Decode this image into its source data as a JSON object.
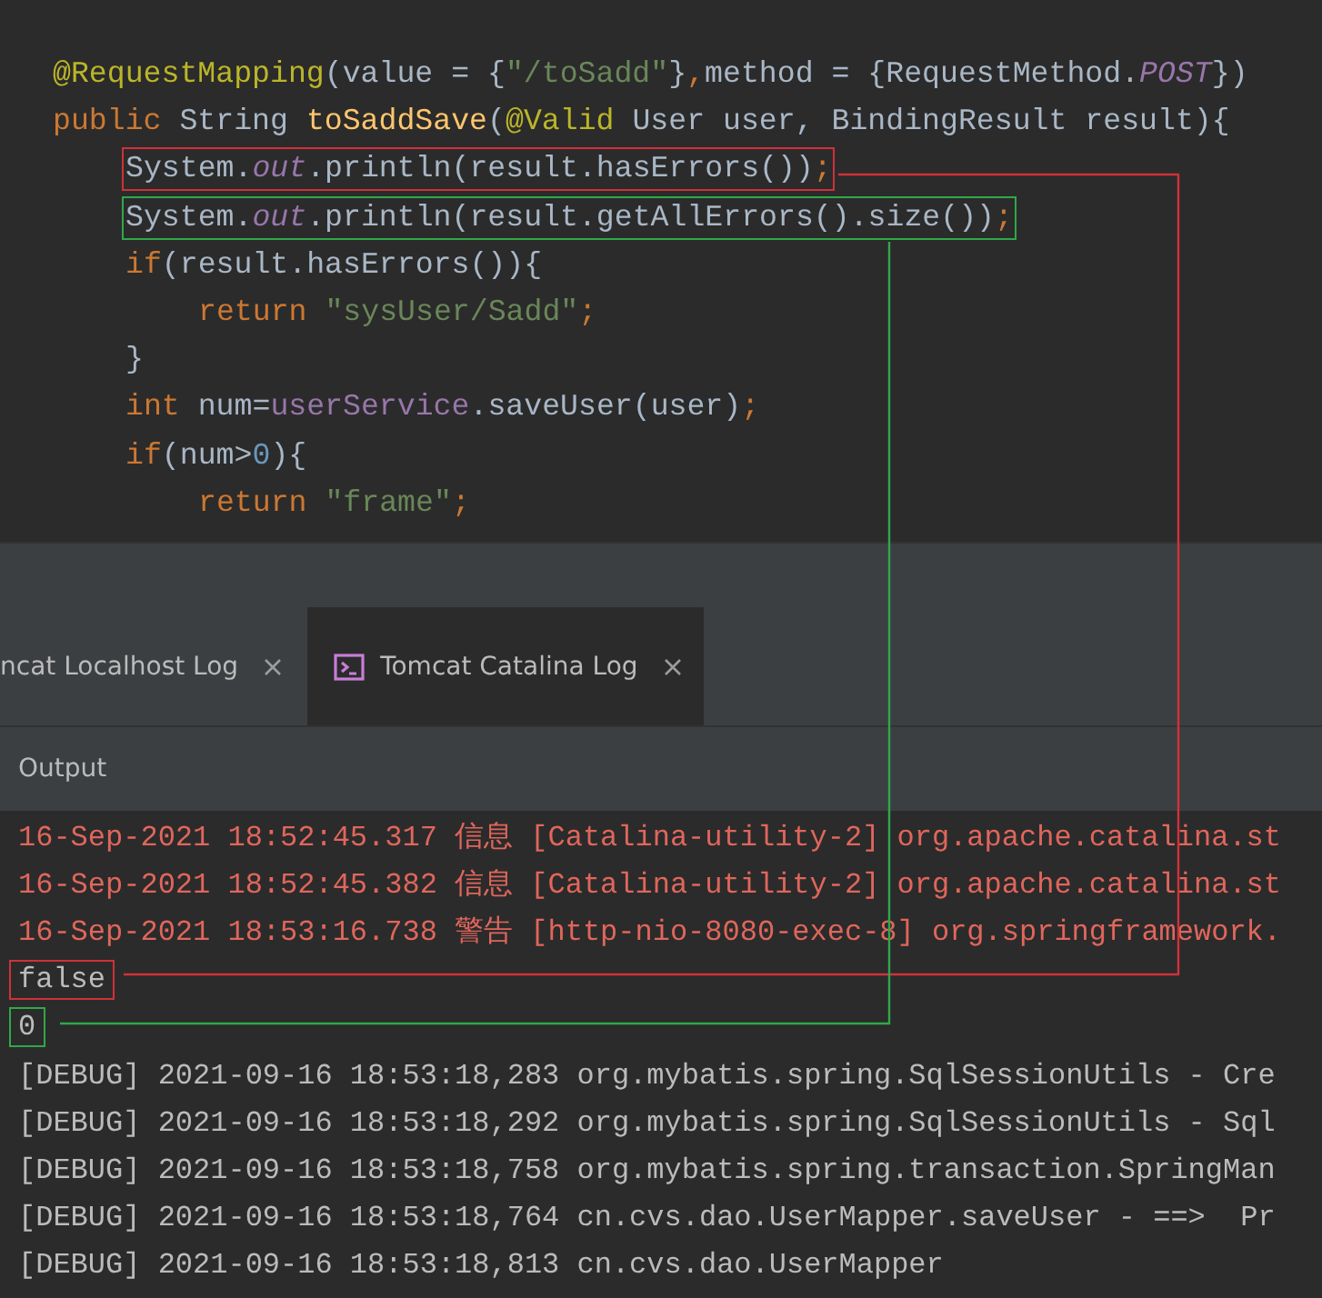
{
  "editor": {
    "lines": [
      {
        "tokens": [
          {
            "kind": "annotation",
            "text": "@RequestMapping"
          },
          {
            "kind": "plain",
            "text": "(value = {"
          },
          {
            "kind": "string",
            "text": "\"/toSadd\""
          },
          {
            "kind": "plain",
            "text": "}"
          },
          {
            "kind": "keyword",
            "text": ","
          },
          {
            "kind": "plain",
            "text": "method = {RequestMethod."
          },
          {
            "kind": "constant",
            "text": "POST"
          },
          {
            "kind": "plain",
            "text": "})"
          }
        ]
      },
      {
        "tokens": [
          {
            "kind": "keyword",
            "text": "public "
          },
          {
            "kind": "plain",
            "text": "String "
          },
          {
            "kind": "method",
            "text": "toSaddSave"
          },
          {
            "kind": "plain",
            "text": "("
          },
          {
            "kind": "annotation",
            "text": "@Valid"
          },
          {
            "kind": "plain",
            "text": " User user, BindingResult result){"
          }
        ],
        "children": [
          {
            "color": "#d0313a",
            "tokens": [
              {
                "kind": "plain",
                "text": "System."
              },
              {
                "kind": "constant",
                "text": "out"
              },
              {
                "kind": "plain",
                "text": ".println(result.hasErrors())"
              },
              {
                "kind": "keyword",
                "text": ";"
              }
            ]
          },
          {
            "color": "#2fa84a",
            "tokens": [
              {
                "kind": "plain",
                "text": "System."
              },
              {
                "kind": "constant",
                "text": "out"
              },
              {
                "kind": "plain",
                "text": ".println(result.getAllErrors().size())"
              },
              {
                "kind": "keyword",
                "text": ";"
              }
            ]
          },
          {
            "tokens": [
              {
                "kind": "keyword",
                "text": "if"
              },
              {
                "kind": "plain",
                "text": "(result.hasErrors()){"
              }
            ],
            "children": [
              {
                "tokens": [
                  {
                    "kind": "keyword",
                    "text": "return "
                  },
                  {
                    "kind": "string",
                    "text": "\"sysUser/Sadd\""
                  },
                  {
                    "kind": "keyword",
                    "text": ";"
                  }
                ]
              }
            ]
          },
          {
            "tokens": [
              {
                "kind": "plain",
                "text": "}"
              }
            ]
          },
          {
            "tokens": [
              {
                "kind": "keyword",
                "text": "int "
              },
              {
                "kind": "plain",
                "text": "num="
              },
              {
                "kind": "member",
                "text": "userService"
              },
              {
                "kind": "plain",
                "text": ".saveUser(user)"
              },
              {
                "kind": "keyword",
                "text": ";"
              }
            ]
          },
          {
            "tokens": [
              {
                "kind": "keyword",
                "text": "if"
              },
              {
                "kind": "plain",
                "text": "(num>"
              },
              {
                "kind": "number",
                "text": "0"
              },
              {
                "kind": "plain",
                "text": "){"
              }
            ],
            "children": [
              {
                "tokens": [
                  {
                    "kind": "keyword",
                    "text": "return "
                  },
                  {
                    "kind": "string",
                    "text": "\"frame\""
                  },
                  {
                    "kind": "keyword",
                    "text": ";"
                  }
                ]
              }
            ]
          }
        ]
      }
    ]
  },
  "tabs": [
    {
      "label": "ncat Localhost Log",
      "selected": false
    },
    {
      "label": "Tomcat Catalina Log",
      "selected": true
    }
  ],
  "panel": {
    "title": "Output"
  },
  "console": [
    {
      "kind": "error",
      "text": "16-Sep-2021 18:52:45.317 信息 [Catalina-utility-2] org.apache.catalina.st"
    },
    {
      "kind": "error",
      "text": "16-Sep-2021 18:52:45.382 信息 [Catalina-utility-2] org.apache.catalina.st"
    },
    {
      "kind": "error",
      "text": "16-Sep-2021 18:53:16.738 警告 [http-nio-8080-exec-8] org.springframework."
    },
    {
      "kind": "output",
      "text": "false",
      "color": "#d0313a"
    },
    {
      "kind": "output",
      "text": "0",
      "color": "#2fa84a"
    },
    {
      "kind": "output",
      "text": "[DEBUG] 2021-09-16 18:53:18,283 org.mybatis.spring.SqlSessionUtils - Cre"
    },
    {
      "kind": "output",
      "text": "[DEBUG] 2021-09-16 18:53:18,292 org.mybatis.spring.SqlSessionUtils - Sql"
    },
    {
      "kind": "output",
      "text": "[DEBUG] 2021-09-16 18:53:18,758 org.mybatis.spring.transaction.SpringMan"
    },
    {
      "kind": "output",
      "text": "[DEBUG] 2021-09-16 18:53:18,764 cn.cvs.dao.UserMapper.saveUser - ==>  Pr"
    },
    {
      "kind": "output",
      "text": "[DEBUG] 2021-09-16 18:53:18,813 cn.cvs.dao.UserMapper"
    }
  ]
}
